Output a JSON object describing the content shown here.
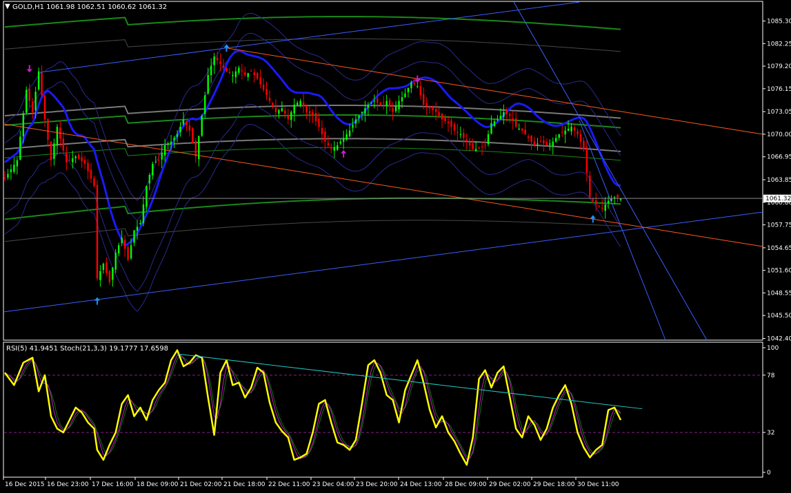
{
  "main_header": {
    "arrow": "▼",
    "text": "GOLD,H1  1061.98 1062.51 1060.62 1061.32"
  },
  "indicator_header": {
    "text": "RSI(5) 41.9451  Stoch(21,3,3) 19.1777 17.6598"
  },
  "current_price": "1061.32",
  "colors": {
    "background": "#000000",
    "frame": "#ffffff",
    "bull": "#00ff00",
    "bear": "#ff0000",
    "trendline_blue": "#3a5fff",
    "trendline_red": "#ff5a1e",
    "mid_band": "#1a1aff",
    "band_dark": "#2a2a90",
    "ma_green": "#1a8a1a",
    "ma_gray": "#7a7a7a",
    "rsi": "#ffff00",
    "stoch_main": "#c81ec8",
    "stoch_signal": "#0a7a0a",
    "cyan_trend": "#1ec8c8",
    "level_line": "#8a1e8a"
  },
  "chart_data": [
    {
      "type": "candlestick",
      "symbol": "GOLD",
      "timeframe": "H1",
      "price_ticks": [
        "1085.30",
        "1082.25",
        "1079.20",
        "1076.15",
        "1073.05",
        "1070.00",
        "1066.95",
        "1063.85",
        "1060.80",
        "1057.75",
        "1054.65",
        "1051.60",
        "1048.55",
        "1045.50",
        "1042.40"
      ],
      "ylim": [
        1042.4,
        1086.5
      ],
      "time_ticks": [
        "16 Dec 2015",
        "16 Dec 23:00",
        "17 Dec 16:00",
        "18 Dec 09:00",
        "21 Dec 02:00",
        "21 Dec 18:00",
        "22 Dec 11:00",
        "23 Dec 04:00",
        "23 Dec 20:00",
        "24 Dec 13:00",
        "28 Dec 09:00",
        "29 Dec 02:00",
        "29 Dec 18:00",
        "30 Dec 11:00"
      ],
      "last_price": 1061.32,
      "close_path": [
        [
          0,
          1064.0
        ],
        [
          4,
          1066.5
        ],
        [
          7,
          1076.0
        ],
        [
          9,
          1073.0
        ],
        [
          11,
          1078.5
        ],
        [
          13,
          1072.0
        ],
        [
          15,
          1066.5
        ],
        [
          17,
          1071.0
        ],
        [
          20,
          1066.2
        ],
        [
          23,
          1067.0
        ],
        [
          26,
          1066.0
        ],
        [
          29,
          1063.0
        ],
        [
          30,
          1050.5
        ],
        [
          32,
          1052.5
        ],
        [
          34,
          1050.0
        ],
        [
          36,
          1054.0
        ],
        [
          38,
          1056.0
        ],
        [
          40,
          1053.0
        ],
        [
          42,
          1057.0
        ],
        [
          44,
          1058.0
        ],
        [
          46,
          1063.0
        ],
        [
          48,
          1066.0
        ],
        [
          50,
          1066.5
        ],
        [
          52,
          1068.5
        ],
        [
          54,
          1069.0
        ],
        [
          56,
          1070.0
        ],
        [
          58,
          1072.0
        ],
        [
          60,
          1070.5
        ],
        [
          62,
          1067.0
        ],
        [
          64,
          1072.5
        ],
        [
          66,
          1078.0
        ],
        [
          68,
          1080.5
        ],
        [
          70,
          1079.5
        ],
        [
          72,
          1078.5
        ],
        [
          74,
          1078.0
        ],
        [
          76,
          1079.0
        ],
        [
          78,
          1078.0
        ],
        [
          80,
          1078.5
        ],
        [
          82,
          1077.5
        ],
        [
          84,
          1076.0
        ],
        [
          86,
          1074.5
        ],
        [
          88,
          1073.0
        ],
        [
          90,
          1073.5
        ],
        [
          92,
          1072.0
        ],
        [
          94,
          1074.0
        ],
        [
          96,
          1074.5
        ],
        [
          98,
          1073.0
        ],
        [
          100,
          1072.5
        ],
        [
          102,
          1071.0
        ],
        [
          104,
          1069.0
        ],
        [
          106,
          1068.0
        ],
        [
          108,
          1068.5
        ],
        [
          110,
          1069.5
        ],
        [
          112,
          1070.5
        ],
        [
          114,
          1072.0
        ],
        [
          116,
          1073.0
        ],
        [
          118,
          1074.0
        ],
        [
          120,
          1074.5
        ],
        [
          122,
          1074.0
        ],
        [
          124,
          1074.5
        ],
        [
          126,
          1073.0
        ],
        [
          128,
          1074.5
        ],
        [
          130,
          1075.5
        ],
        [
          132,
          1077.0
        ],
        [
          134,
          1076.5
        ],
        [
          136,
          1074.0
        ],
        [
          138,
          1073.5
        ],
        [
          140,
          1073.0
        ],
        [
          142,
          1072.0
        ],
        [
          144,
          1071.5
        ],
        [
          146,
          1070.5
        ],
        [
          148,
          1070.0
        ],
        [
          150,
          1069.0
        ],
        [
          152,
          1068.0
        ],
        [
          154,
          1068.0
        ],
        [
          156,
          1068.5
        ],
        [
          158,
          1071.5
        ],
        [
          160,
          1072.0
        ],
        [
          162,
          1073.0
        ],
        [
          164,
          1072.5
        ],
        [
          166,
          1071.0
        ],
        [
          168,
          1070.5
        ],
        [
          170,
          1069.5
        ],
        [
          172,
          1068.5
        ],
        [
          174,
          1069.0
        ],
        [
          176,
          1068.5
        ],
        [
          178,
          1069.0
        ],
        [
          180,
          1070.0
        ],
        [
          182,
          1070.5
        ],
        [
          184,
          1071.0
        ],
        [
          186,
          1070.0
        ],
        [
          188,
          1068.0
        ],
        [
          190,
          1061.5
        ],
        [
          192,
          1060.5
        ],
        [
          194,
          1060.0
        ],
        [
          196,
          1061.0
        ],
        [
          198,
          1061.5
        ],
        [
          200,
          1061.3
        ]
      ],
      "annotations": {
        "swing_markers": [
          {
            "kind": "down-arrow",
            "color": "#c81ec8",
            "bar": 8,
            "price": 1078.7
          },
          {
            "kind": "up-arrow",
            "color": "#1e90ff",
            "bar": 30,
            "price": 1047.6
          },
          {
            "kind": "up-arrow",
            "color": "#1e90ff",
            "bar": 72,
            "price": 1081.8
          },
          {
            "kind": "down-arrow",
            "color": "#c81ec8",
            "bar": 134,
            "price": 1077.3
          },
          {
            "kind": "up-arrow",
            "color": "#c81ec8",
            "bar": 110,
            "price": 1067.5
          },
          {
            "kind": "up-arrow",
            "color": "#1e90ff",
            "bar": 191,
            "price": 1058.7
          }
        ]
      }
    },
    {
      "type": "line",
      "name": "RSI(5) / Stoch(21,3,3)",
      "ticks": [
        "100",
        "78",
        "32",
        "0"
      ],
      "ylim": [
        0,
        100
      ],
      "levels": [
        78,
        32
      ],
      "rsi_points": [
        [
          0,
          80
        ],
        [
          3,
          70
        ],
        [
          6,
          88
        ],
        [
          9,
          92
        ],
        [
          11,
          65
        ],
        [
          13,
          78
        ],
        [
          15,
          45
        ],
        [
          17,
          35
        ],
        [
          19,
          32
        ],
        [
          21,
          42
        ],
        [
          23,
          52
        ],
        [
          25,
          48
        ],
        [
          27,
          40
        ],
        [
          29,
          35
        ],
        [
          30,
          18
        ],
        [
          32,
          10
        ],
        [
          34,
          22
        ],
        [
          36,
          32
        ],
        [
          38,
          55
        ],
        [
          40,
          62
        ],
        [
          42,
          45
        ],
        [
          44,
          52
        ],
        [
          46,
          42
        ],
        [
          48,
          58
        ],
        [
          50,
          66
        ],
        [
          52,
          72
        ],
        [
          54,
          90
        ],
        [
          56,
          98
        ],
        [
          58,
          85
        ],
        [
          60,
          88
        ],
        [
          62,
          94
        ],
        [
          64,
          92
        ],
        [
          66,
          60
        ],
        [
          68,
          30
        ],
        [
          70,
          80
        ],
        [
          72,
          90
        ],
        [
          74,
          70
        ],
        [
          76,
          72
        ],
        [
          78,
          60
        ],
        [
          80,
          68
        ],
        [
          82,
          84
        ],
        [
          84,
          80
        ],
        [
          86,
          56
        ],
        [
          88,
          40
        ],
        [
          90,
          33
        ],
        [
          92,
          28
        ],
        [
          94,
          10
        ],
        [
          96,
          12
        ],
        [
          98,
          15
        ],
        [
          100,
          32
        ],
        [
          102,
          55
        ],
        [
          104,
          58
        ],
        [
          106,
          40
        ],
        [
          108,
          24
        ],
        [
          110,
          22
        ],
        [
          112,
          18
        ],
        [
          114,
          26
        ],
        [
          116,
          55
        ],
        [
          118,
          86
        ],
        [
          120,
          90
        ],
        [
          122,
          80
        ],
        [
          124,
          62
        ],
        [
          126,
          58
        ],
        [
          128,
          40
        ],
        [
          130,
          66
        ],
        [
          132,
          78
        ],
        [
          134,
          90
        ],
        [
          136,
          72
        ],
        [
          138,
          50
        ],
        [
          140,
          36
        ],
        [
          142,
          45
        ],
        [
          144,
          32
        ],
        [
          146,
          25
        ],
        [
          148,
          15
        ],
        [
          150,
          6
        ],
        [
          152,
          28
        ],
        [
          154,
          75
        ],
        [
          156,
          82
        ],
        [
          158,
          68
        ],
        [
          160,
          80
        ],
        [
          162,
          85
        ],
        [
          164,
          60
        ],
        [
          166,
          35
        ],
        [
          168,
          28
        ],
        [
          170,
          45
        ],
        [
          172,
          38
        ],
        [
          174,
          26
        ],
        [
          176,
          35
        ],
        [
          178,
          52
        ],
        [
          180,
          62
        ],
        [
          182,
          70
        ],
        [
          184,
          55
        ],
        [
          186,
          32
        ],
        [
          188,
          20
        ],
        [
          190,
          12
        ],
        [
          192,
          18
        ],
        [
          194,
          22
        ],
        [
          196,
          50
        ],
        [
          198,
          52
        ],
        [
          200,
          42
        ]
      ],
      "cyan_trend_points": [
        [
          56,
          95
        ],
        [
          207,
          51
        ]
      ]
    }
  ]
}
